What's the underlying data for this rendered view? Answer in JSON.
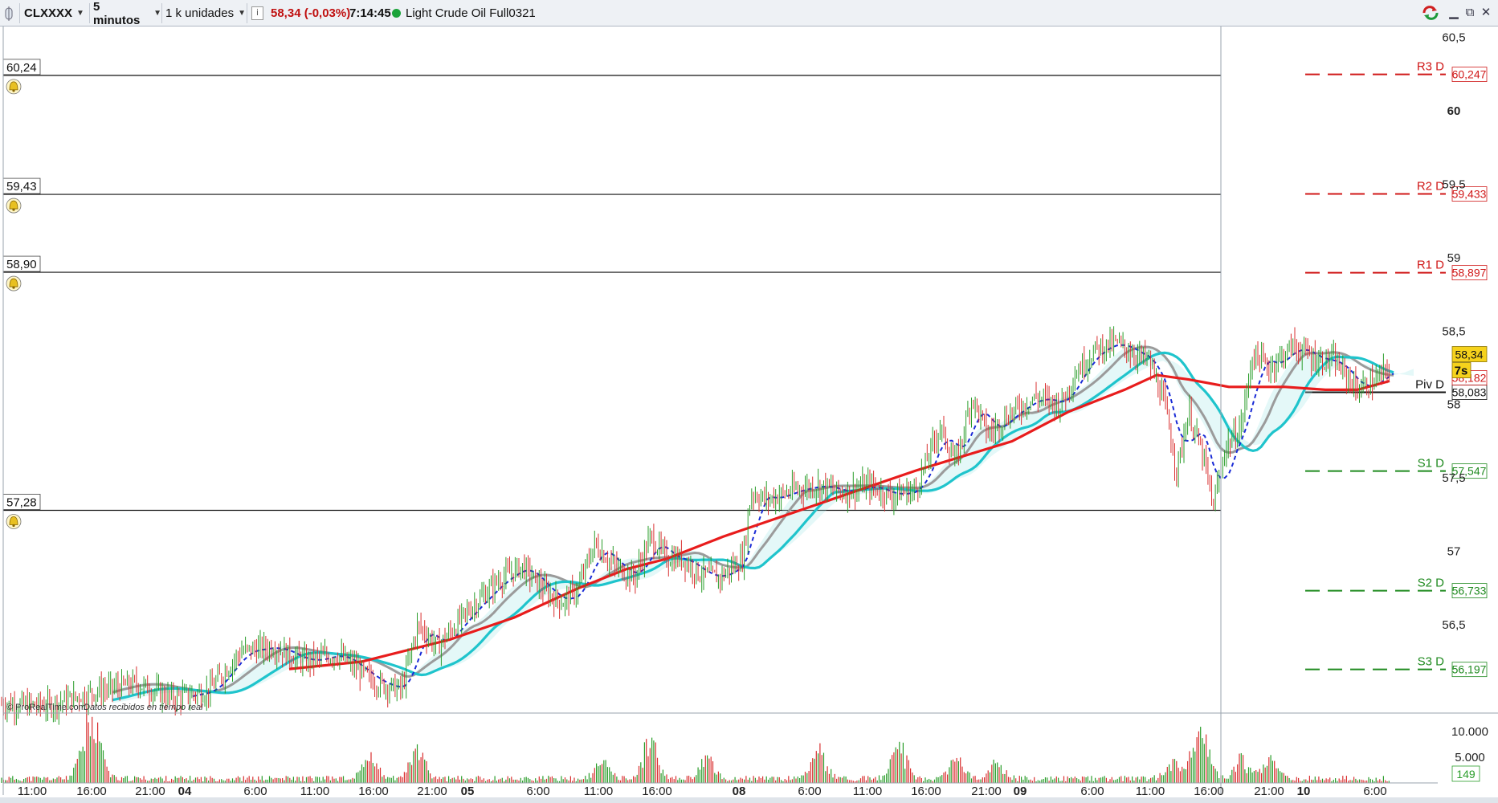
{
  "toolbar": {
    "symbol": "CLXXXX",
    "interval": "5 minutos",
    "units": "1 k unidades",
    "info_icon": "i",
    "price_change": "58,34 (-0,03%)",
    "time": "7:14:45",
    "status_color": "#1aa33a",
    "instrument_name": "Light Crude Oil Full0321",
    "window_buttons": {
      "restore": "⧉",
      "close": "✕"
    }
  },
  "watermark": "© ProRealTime.com",
  "watermark_sub": "Datos recibidos en tiempo real",
  "chart_data": {
    "type": "candlestick",
    "instrument": "Light Crude Oil Full0321",
    "interval": "5 minutos",
    "last_price": 58.34,
    "last_price_label": "58,34",
    "countdown": "7s",
    "ylim": [
      55.9,
      60.6
    ],
    "y_ticks": [
      {
        "value": 60.5,
        "label": "60,5"
      },
      {
        "value": 60.0,
        "label": "60",
        "bold": true
      },
      {
        "value": 59.5,
        "label": "59,5"
      },
      {
        "value": 59.0,
        "label": "59"
      },
      {
        "value": 58.5,
        "label": "58,5"
      },
      {
        "value": 58.0,
        "label": "58"
      },
      {
        "value": 57.5,
        "label": "57,5"
      },
      {
        "value": 57.0,
        "label": "57"
      },
      {
        "value": 56.5,
        "label": "56,5"
      }
    ],
    "x_ticks": [
      {
        "label": "11:00",
        "bold": false
      },
      {
        "label": "16:00",
        "bold": false
      },
      {
        "label": "21:00",
        "bold": false
      },
      {
        "label": "04",
        "bold": true
      },
      {
        "label": "6:00",
        "bold": false
      },
      {
        "label": "11:00",
        "bold": false
      },
      {
        "label": "16:00",
        "bold": false
      },
      {
        "label": "21:00",
        "bold": false
      },
      {
        "label": "05",
        "bold": true
      },
      {
        "label": "6:00",
        "bold": false
      },
      {
        "label": "11:00",
        "bold": false
      },
      {
        "label": "16:00",
        "bold": false
      },
      {
        "label": "08",
        "bold": true
      },
      {
        "label": "6:00",
        "bold": false
      },
      {
        "label": "11:00",
        "bold": false
      },
      {
        "label": "16:00",
        "bold": false
      },
      {
        "label": "21:00",
        "bold": false
      },
      {
        "label": "09",
        "bold": true
      },
      {
        "label": "6:00",
        "bold": false
      },
      {
        "label": "11:00",
        "bold": false
      },
      {
        "label": "16:00",
        "bold": false
      },
      {
        "label": "21:00",
        "bold": false
      },
      {
        "label": "10",
        "bold": true
      },
      {
        "label": "6:00",
        "bold": false
      }
    ],
    "horizontal_lines": [
      {
        "value": 60.24,
        "label": "60,24"
      },
      {
        "value": 59.43,
        "label": "59,43"
      },
      {
        "value": 58.9,
        "label": "58,90"
      },
      {
        "value": 57.28,
        "label": "57,28"
      }
    ],
    "pivot_levels": [
      {
        "name": "R3 D",
        "value": 60.247,
        "label": "60,247",
        "color": "#d01818",
        "style": "dashed"
      },
      {
        "name": "R2 D",
        "value": 59.433,
        "label": "59,433",
        "color": "#d01818",
        "style": "dashed"
      },
      {
        "name": "R1 D",
        "value": 58.897,
        "label": "58,897",
        "color": "#d01818",
        "style": "dashed"
      },
      {
        "name": "Piv D",
        "value": 58.083,
        "label": "58,083",
        "color": "#111111",
        "style": "solid"
      },
      {
        "name": "S1 D",
        "value": 57.547,
        "label": "57,547",
        "color": "#1f8a1f",
        "style": "dashed"
      },
      {
        "name": "S2 D",
        "value": 56.733,
        "label": "56,733",
        "color": "#1f8a1f",
        "style": "dashed"
      },
      {
        "name": "S3 D",
        "value": 56.197,
        "label": "56,197",
        "color": "#1f8a1f",
        "style": "dashed"
      }
    ],
    "indicator_labels": [
      {
        "value": 58.182,
        "label": "58,182",
        "color": "#d01818"
      }
    ],
    "trend_path": [
      [
        0,
        55.96
      ],
      [
        60,
        55.95
      ],
      [
        120,
        56.05
      ],
      [
        170,
        56.1
      ],
      [
        215,
        56.0
      ],
      [
        260,
        56.05
      ],
      [
        300,
        56.32
      ],
      [
        340,
        56.35
      ],
      [
        380,
        56.25
      ],
      [
        420,
        56.3
      ],
      [
        470,
        56.1
      ],
      [
        500,
        56.06
      ],
      [
        520,
        56.5
      ],
      [
        545,
        56.35
      ],
      [
        580,
        56.58
      ],
      [
        620,
        56.8
      ],
      [
        650,
        56.9
      ],
      [
        680,
        56.72
      ],
      [
        700,
        56.65
      ],
      [
        720,
        56.75
      ],
      [
        740,
        57.05
      ],
      [
        765,
        56.9
      ],
      [
        790,
        56.82
      ],
      [
        810,
        57.1
      ],
      [
        830,
        56.95
      ],
      [
        850,
        56.95
      ],
      [
        870,
        56.85
      ],
      [
        895,
        56.82
      ],
      [
        925,
        56.95
      ],
      [
        935,
        57.4
      ],
      [
        955,
        57.35
      ],
      [
        990,
        57.42
      ],
      [
        1020,
        57.45
      ],
      [
        1050,
        57.4
      ],
      [
        1080,
        57.45
      ],
      [
        1110,
        57.38
      ],
      [
        1140,
        57.42
      ],
      [
        1170,
        57.85
      ],
      [
        1190,
        57.6
      ],
      [
        1210,
        58.05
      ],
      [
        1230,
        57.8
      ],
      [
        1260,
        57.95
      ],
      [
        1290,
        58.05
      ],
      [
        1320,
        58.0
      ],
      [
        1340,
        58.22
      ],
      [
        1365,
        58.38
      ],
      [
        1390,
        58.42
      ],
      [
        1410,
        58.35
      ],
      [
        1430,
        58.3
      ],
      [
        1450,
        58.0
      ],
      [
        1465,
        57.55
      ],
      [
        1480,
        57.95
      ],
      [
        1500,
        57.6
      ],
      [
        1510,
        57.3
      ],
      [
        1525,
        57.7
      ],
      [
        1545,
        57.85
      ],
      [
        1560,
        58.35
      ],
      [
        1580,
        58.25
      ],
      [
        1610,
        58.4
      ],
      [
        1640,
        58.3
      ],
      [
        1660,
        58.3
      ],
      [
        1690,
        58.1
      ],
      [
        1710,
        58.15
      ],
      [
        1730,
        58.25
      ]
    ],
    "volume_ticks": [
      {
        "value": 10000,
        "label": "10.000"
      },
      {
        "value": 5000,
        "label": "5.000"
      }
    ],
    "last_volume": "149",
    "volume_max": 12500,
    "volume_peaks": [
      [
        108,
        11000
      ],
      [
        120,
        9000
      ],
      [
        460,
        5500
      ],
      [
        520,
        7000
      ],
      [
        750,
        4500
      ],
      [
        810,
        9500
      ],
      [
        880,
        5000
      ],
      [
        1020,
        6500
      ],
      [
        1120,
        8000
      ],
      [
        1190,
        5500
      ],
      [
        1240,
        4000
      ],
      [
        1460,
        4500
      ],
      [
        1490,
        6500
      ],
      [
        1500,
        7000
      ],
      [
        1545,
        5000
      ],
      [
        1580,
        5500
      ]
    ]
  }
}
